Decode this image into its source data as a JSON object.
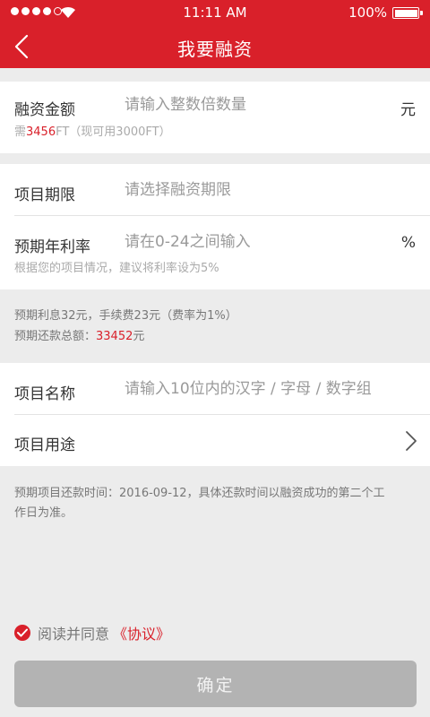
{
  "status_bar": {
    "time": "11:11 AM",
    "battery": "100%"
  },
  "nav": {
    "title": "我要融资",
    "back_icon": "chevron-left-icon"
  },
  "amount": {
    "label": "融资金额",
    "placeholder": "请输入整数倍数量",
    "unit": "元",
    "hint_prefix": "需",
    "hint_amount": "3456",
    "hint_suffix": "FT（现可用3000FT）"
  },
  "term": {
    "label": "项目期限",
    "placeholder": "请选择融资期限"
  },
  "rate": {
    "label": "预期年利率",
    "placeholder": "请在0-24之间输入",
    "unit": "%",
    "hint": "根据您的项目情况，建议将利率设为5%"
  },
  "summary": {
    "interest_line": "预期利息32元，手续费23元（费率为1%）",
    "total_label": "预期还款总额：",
    "total_amount": "33452",
    "total_unit": "元"
  },
  "project_name": {
    "label": "项目名称",
    "placeholder": "请输入10位内的汉字 / 字母 / 数字组"
  },
  "project_use": {
    "label": "项目用途",
    "arrow_icon": "chevron-right-icon"
  },
  "notice": {
    "line1": "预期项目还款时间：2016-09-12，具体还款时间以融资成功的第二个工",
    "line2": "作日为准。"
  },
  "agreement": {
    "text": "阅读并同意",
    "link": "《协议》"
  },
  "confirm_label": "确定",
  "colors": {
    "brand": "#d9202a",
    "background": "#ececec",
    "button_disabled": "#b3b3b3"
  }
}
